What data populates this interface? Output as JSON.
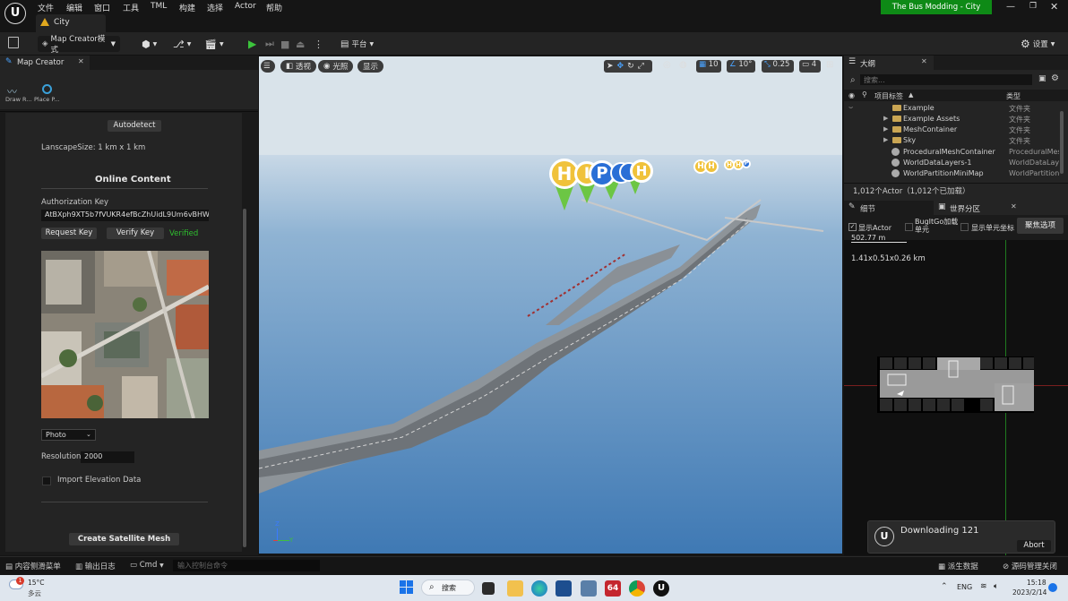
{
  "menu": [
    "文件",
    "编辑",
    "窗口",
    "工具",
    "TML",
    "构建",
    "选择",
    "Actor",
    "帮助"
  ],
  "project_badge": "The Bus Modding - City",
  "level_tab": "City",
  "toolbar": {
    "mode_label": "Map Creator模式",
    "platform_label": "平台",
    "settings_label": "设置"
  },
  "map_creator": {
    "tab_title": "Map Creator",
    "tools": [
      "Draw R...",
      "Place P..."
    ],
    "autodetect_label": "Autodetect",
    "landscape_size": "LanscapeSize: 1 km x 1 km",
    "online_content_title": "Online Content",
    "auth_key_label": "Authorization Key",
    "auth_key_value": "AtBXph9XT5b7fVUKR4efBcZhUidL9Um6vBHW_",
    "request_key_label": "Request Key",
    "verify_key_label": "Verify Key",
    "verified_label": "Verified",
    "image_type_value": "Photo",
    "resolution_label": "Resolution:",
    "resolution_value": "2000",
    "import_elevation_label": "Import Elevation Data",
    "create_mesh_label": "Create Satellite Mesh"
  },
  "viewport": {
    "perspective_label": "透视",
    "lighting_label": "光照",
    "show_label": "显示",
    "grid_value": "10",
    "angle_value": "10°",
    "scale_value": "0.25",
    "camera_speed_value": "4"
  },
  "outliner": {
    "tab_title": "大纲",
    "search_placeholder": "搜索...",
    "col_label": "项目标签",
    "col_type": "类型",
    "rows": [
      {
        "name": "Example",
        "type": "文件夹"
      },
      {
        "name": "Example Assets",
        "type": "文件夹"
      },
      {
        "name": "MeshContainer",
        "type": "文件夹"
      },
      {
        "name": "Sky",
        "type": "文件夹"
      },
      {
        "name": "ProceduralMeshContainer",
        "type": "ProceduralMes"
      },
      {
        "name": "WorldDataLayers-1",
        "type": "WorldDataLaye"
      },
      {
        "name": "WorldPartitionMiniMap",
        "type": "WorldPartition"
      }
    ],
    "actor_count": "1,012个Actor（1,012个已加载）"
  },
  "world_partition": {
    "details_tab": "细节",
    "wp_tab": "世界分区",
    "show_actor_label": "显示Actor",
    "bugitgo_label": "BugItGo加载单元",
    "show_cell_coords_label": "显示单元坐标",
    "focus_selection_label": "聚焦选项",
    "distance_readout": "502.77 m",
    "size_readout": "1.41x0.51x0.26 km"
  },
  "notification": {
    "title": "Downloading 121",
    "abort_label": "Abort"
  },
  "statusbar": {
    "content_drawer": "内容侧滑菜单",
    "output_log": "输出日志",
    "cmd_label": "Cmd",
    "console_placeholder": "输入控制台命令",
    "derived_data": "派生数据",
    "source_control": "源码管理关闭"
  },
  "taskbar": {
    "weather_temp": "15°C",
    "weather_desc": "多云",
    "weather_badge": "1",
    "search_label": "搜索",
    "app_64_label": "64",
    "lang": "ENG",
    "time": "15:18",
    "date": "2023/2/14"
  },
  "colors": {
    "accent_green": "#0e8a16",
    "viewport_sky": "#4a84bd",
    "verified_green": "#2fbf2f",
    "map_marker_yellow": "#f0c23b",
    "map_marker_blue": "#2a6fd6",
    "map_marker_green": "#6cc644"
  }
}
